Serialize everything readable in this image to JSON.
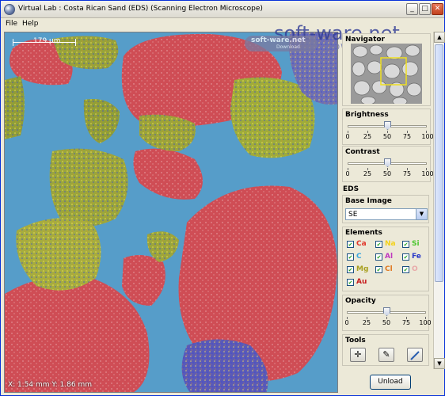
{
  "window": {
    "title": "Virtual Lab : Costa Rican Sand (EDS) (Scanning Electron Microscope)",
    "min_glyph": "_",
    "max_glyph": "□",
    "close_glyph": "✕"
  },
  "menu": {
    "file": "File",
    "help": "Help"
  },
  "viewport": {
    "scale_label": "179 µm",
    "coords": "X: 1.54 mm  Y: 1.86 mm"
  },
  "panel": {
    "navigator_title": "Navigator",
    "brightness": {
      "title": "Brightness",
      "value": 50,
      "labels": [
        "0",
        "25",
        "50",
        "75",
        "100"
      ]
    },
    "contrast": {
      "title": "Contrast",
      "value": 50,
      "labels": [
        "0",
        "25",
        "50",
        "75",
        "100"
      ]
    },
    "eds_title": "EDS",
    "base_image": {
      "title": "Base Image",
      "value": "SE"
    },
    "elements": {
      "title": "Elements",
      "items": [
        {
          "label": "Ca",
          "color": "#e0372b"
        },
        {
          "label": "Na",
          "color": "#f3d21a"
        },
        {
          "label": "Si",
          "color": "#4bc62d"
        },
        {
          "label": "C",
          "color": "#3aa8e0"
        },
        {
          "label": "Al",
          "color": "#c038c0"
        },
        {
          "label": "Fe",
          "color": "#2838c8"
        },
        {
          "label": "Mg",
          "color": "#a8a020"
        },
        {
          "label": "Cl",
          "color": "#e07820"
        },
        {
          "label": "O",
          "color": "#e8a8a8"
        },
        {
          "label": "Au",
          "color": "#c82020"
        }
      ]
    },
    "opacity": {
      "title": "Opacity",
      "value": 50,
      "labels": [
        "0",
        "25",
        "50",
        "75",
        "100"
      ]
    },
    "tools": {
      "title": "Tools",
      "icons": [
        "crosshair-icon",
        "brush-icon",
        "pen-icon"
      ]
    }
  },
  "unload_label": "Unload",
  "watermark": {
    "main": "soft-ware.net",
    "sub": "DOWNLOADS",
    "badge": "soft-ware.net",
    "badge_sub": "Download"
  }
}
